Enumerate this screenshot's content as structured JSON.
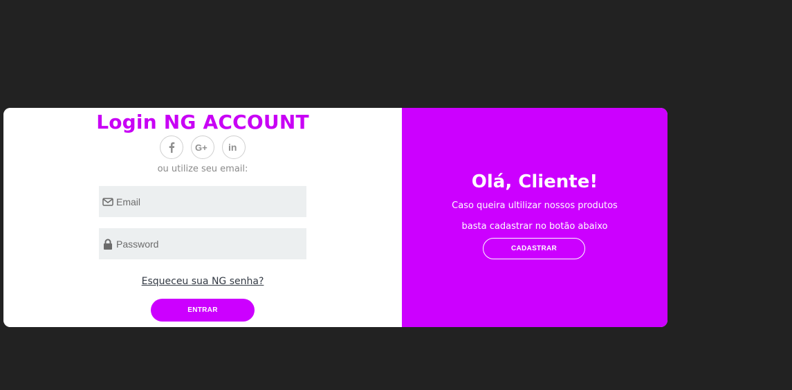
{
  "login": {
    "title": "Login NG ACCOUNT",
    "social": [
      {
        "icon": "facebook-icon",
        "label": "f"
      },
      {
        "icon": "google-plus-icon",
        "label": "G+"
      },
      {
        "icon": "linkedin-icon",
        "label": "in"
      }
    ],
    "subtitle": "ou utilize seu email:",
    "email": {
      "placeholder": "Email",
      "value": ""
    },
    "password": {
      "placeholder": "Password",
      "value": ""
    },
    "forgot_link": "Esqueceu sua NG senha?",
    "submit_label": "ENTRAR"
  },
  "panel": {
    "heading": "Olá, Cliente!",
    "line1": "Caso queira ultilizar nossos produtos",
    "line2": "basta cadastrar no botão abaixo",
    "register_label": "CADASTRAR"
  },
  "colors": {
    "accent": "#cc00ff",
    "background": "#222222",
    "input_bg": "#eceff0"
  }
}
